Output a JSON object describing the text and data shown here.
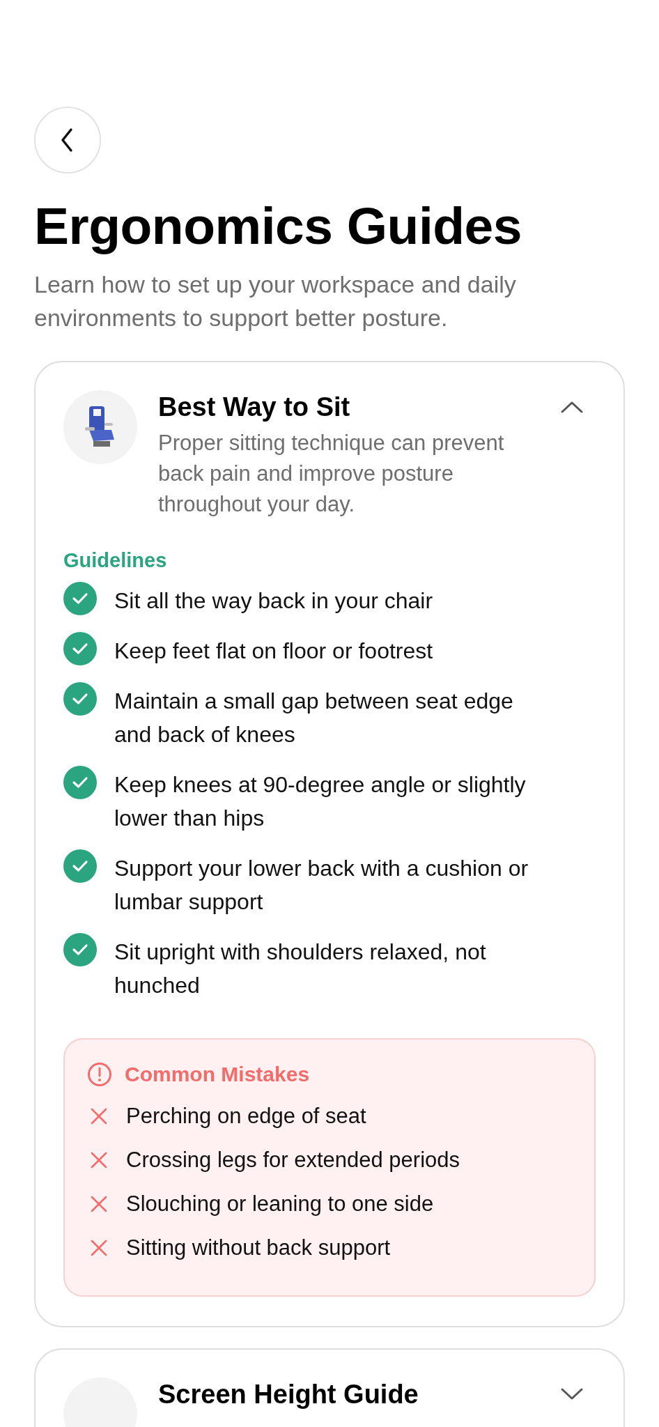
{
  "header": {
    "title": "Ergonomics Guides",
    "subtitle": "Learn how to set up your workspace and daily environments to support better posture."
  },
  "guides": [
    {
      "title": "Best Way to Sit",
      "description": "Proper sitting technique can prevent back pain and improve posture throughout your day.",
      "expanded": true,
      "guidelines_label": "Guidelines",
      "guidelines": [
        "Sit all the way back in your chair",
        "Keep feet flat on floor or footrest",
        "Maintain a small gap between seat edge and back of knees",
        "Keep knees at 90-degree angle or slightly lower than hips",
        "Support your lower back with a cushion or lumbar support",
        "Sit upright with shoulders relaxed, not hunched"
      ],
      "mistakes_label": "Common Mistakes",
      "mistakes": [
        "Perching on edge of seat",
        "Crossing legs for extended periods",
        "Slouching or leaning to one side",
        "Sitting without back support"
      ]
    },
    {
      "title": "Screen Height Guide",
      "expanded": false
    }
  ]
}
